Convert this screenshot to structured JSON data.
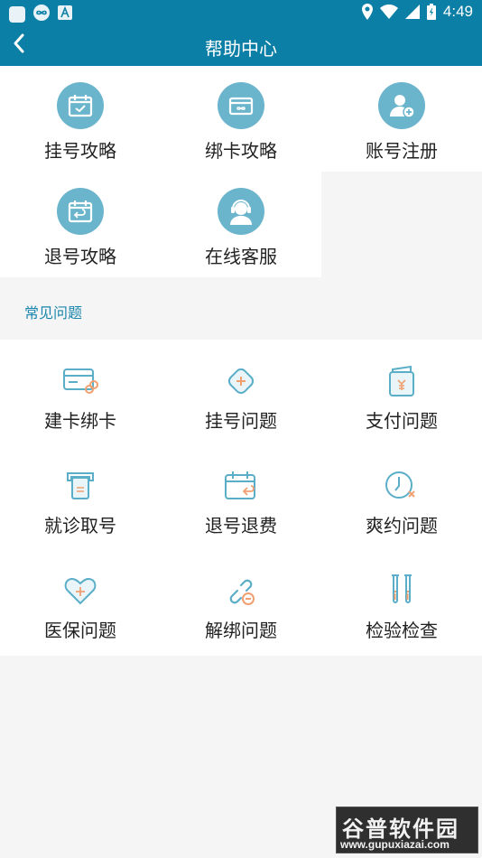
{
  "status_bar": {
    "time": "4:49"
  },
  "header": {
    "title": "帮助中心"
  },
  "guides": [
    {
      "label": "挂号攻略",
      "icon": "calendar-check-icon"
    },
    {
      "label": "绑卡攻略",
      "icon": "card-icon"
    },
    {
      "label": "账号注册",
      "icon": "user-add-icon"
    },
    {
      "label": "退号攻略",
      "icon": "calendar-return-icon"
    },
    {
      "label": "在线客服",
      "icon": "headset-agent-icon"
    }
  ],
  "faq_section": {
    "title": "常见问题",
    "items": [
      {
        "label": "建卡绑卡",
        "icon": "card-link-icon"
      },
      {
        "label": "挂号问题",
        "icon": "medical-plus-icon"
      },
      {
        "label": "支付问题",
        "icon": "wallet-yuan-icon"
      },
      {
        "label": "就诊取号",
        "icon": "ticket-printer-icon"
      },
      {
        "label": "退号退费",
        "icon": "calendar-refund-icon"
      },
      {
        "label": "爽约问题",
        "icon": "clock-cancel-icon"
      },
      {
        "label": "医保问题",
        "icon": "heart-plus-icon"
      },
      {
        "label": "解绑问题",
        "icon": "unlink-icon"
      },
      {
        "label": "检验检查",
        "icon": "test-tubes-icon"
      }
    ]
  },
  "watermark": {
    "logo_text": "谷普软件园",
    "url": "www.gupuxiazai.com"
  },
  "colors": {
    "primary": "#0b7fa6",
    "icon_circle": "#6bb5cc",
    "icon_line": "#5aaec8",
    "icon_accent": "#f0a070"
  }
}
